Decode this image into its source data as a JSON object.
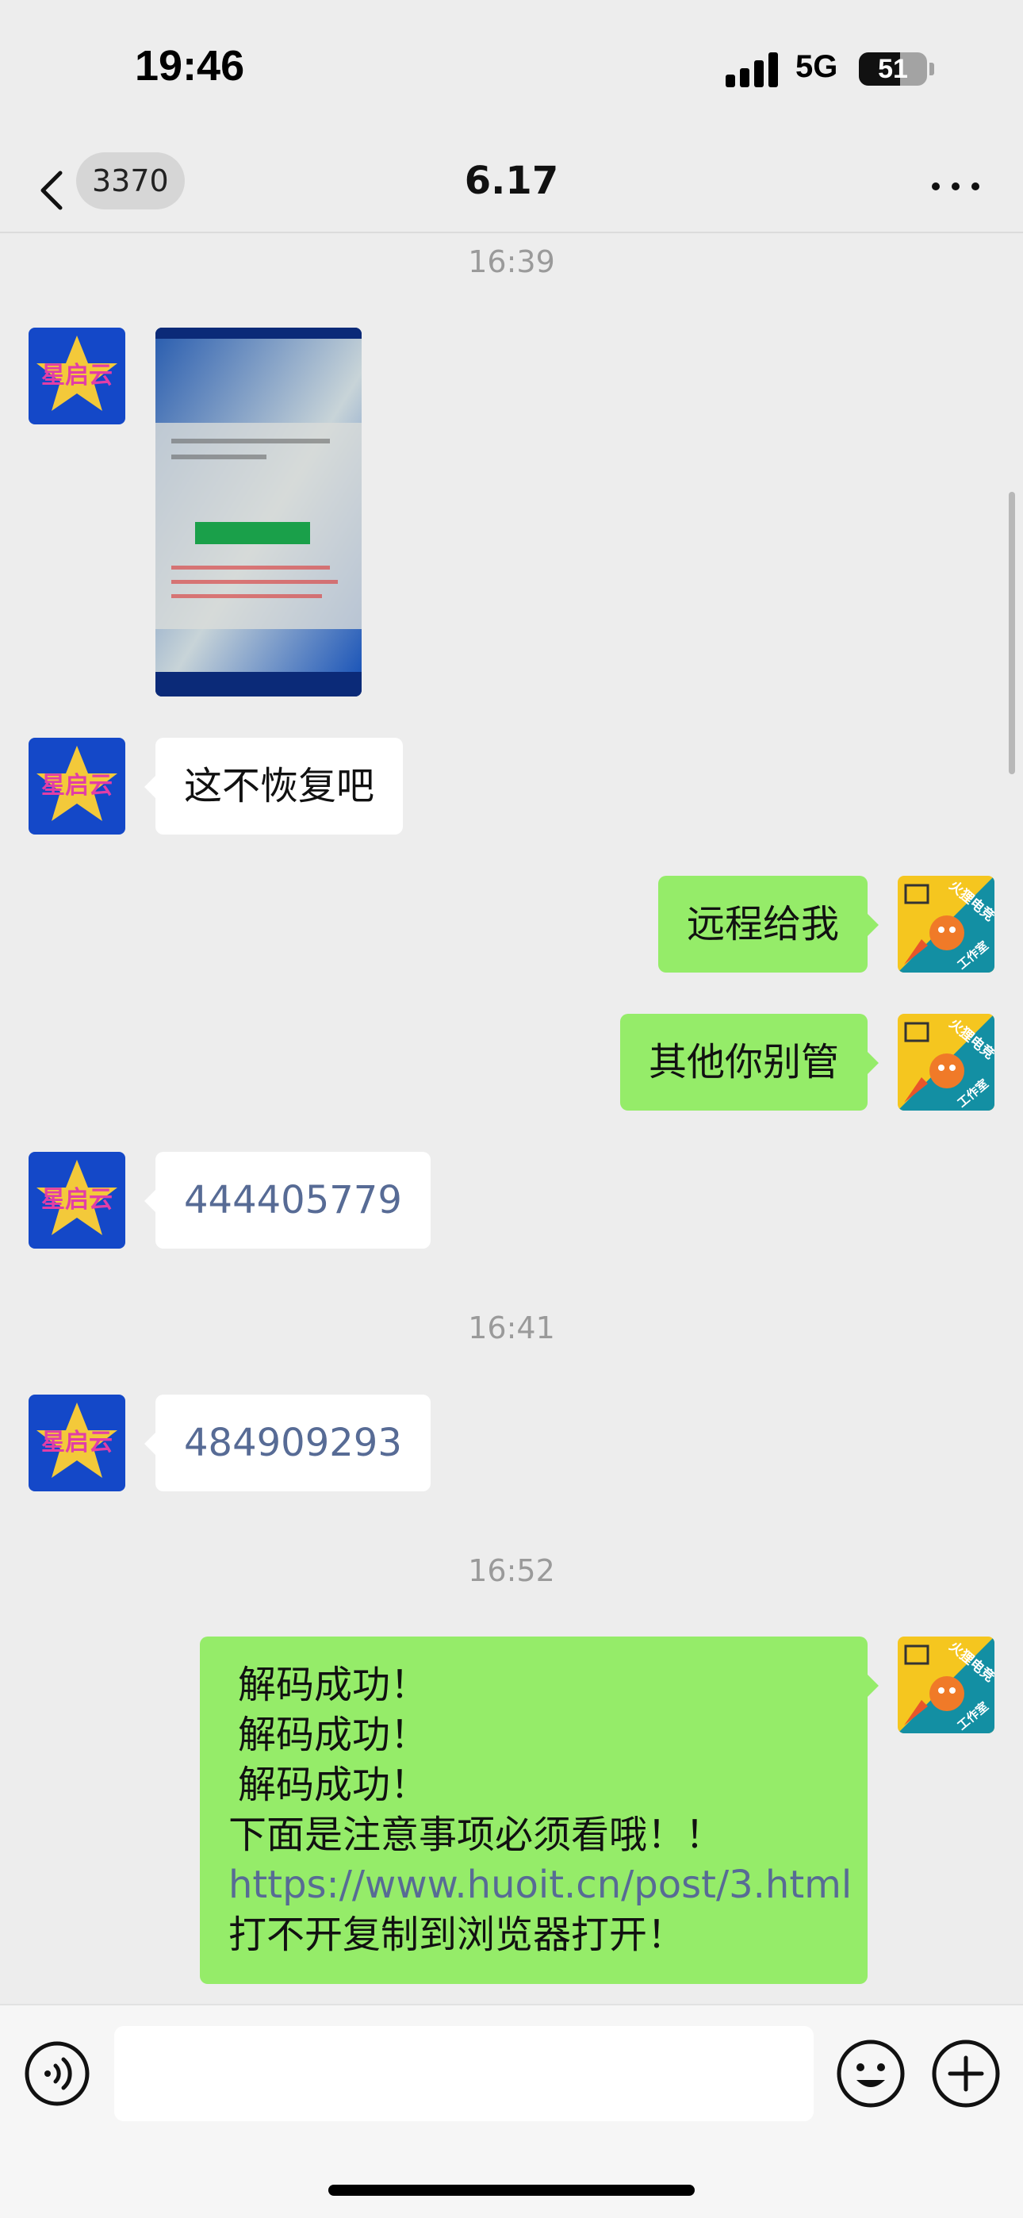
{
  "status_bar": {
    "time": "19:46",
    "network": "5G",
    "battery_level": "51"
  },
  "header": {
    "back_icon": "chevron-left-icon",
    "unread_count": "3370",
    "title": "6.17",
    "more_icon": "ellipsis-icon"
  },
  "messages": [
    {
      "type": "timestamp",
      "text": "16:39"
    },
    {
      "type": "image",
      "direction": "in",
      "image_desc_icon": "photo-thumbnail"
    },
    {
      "type": "text",
      "direction": "in",
      "text": "这不恢复吧"
    },
    {
      "type": "text",
      "direction": "out",
      "text": "远程给我"
    },
    {
      "type": "text",
      "direction": "out",
      "text": "其他你别管"
    },
    {
      "type": "text",
      "direction": "in",
      "text": "444405779"
    },
    {
      "type": "timestamp",
      "text": "16:41"
    },
    {
      "type": "text",
      "direction": "in",
      "text": "484909293"
    },
    {
      "type": "timestamp",
      "text": "16:52"
    },
    {
      "type": "text",
      "direction": "out",
      "lines": [
        "解码成功！",
        "解码成功！",
        "解码成功！",
        "下面是注意事项必须看哦！！",
        "https://www.huoit.cn/post/3.html",
        "打不开复制到浏览器打开！"
      ]
    }
  ],
  "avatars": {
    "contact_text": "星启云",
    "self_text_top": "火狸电竞",
    "self_text_bottom": "工作室"
  },
  "input_bar": {
    "voice_icon": "voice-icon",
    "input_value": "",
    "emoji_icon": "emoji-icon",
    "plus_icon": "plus-icon"
  },
  "colors": {
    "background": "#ededed",
    "bubble_out": "#95ec69",
    "bubble_in": "#ffffff",
    "link": "#576b95",
    "timestamp": "#9a9a9a"
  }
}
